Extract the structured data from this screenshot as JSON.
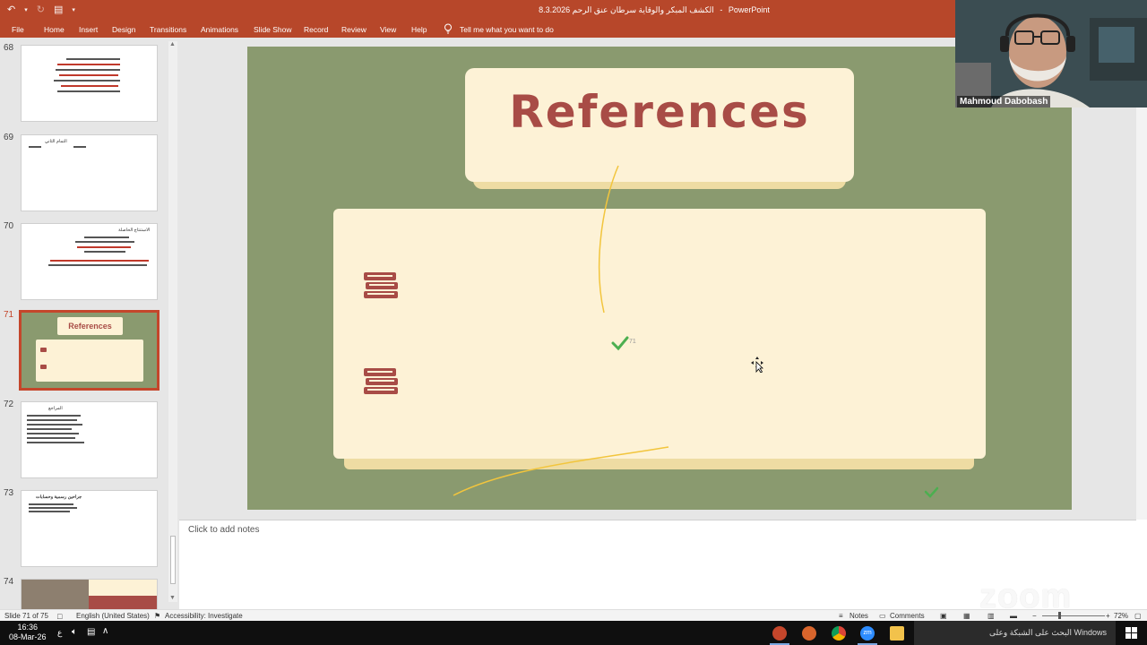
{
  "window": {
    "title": "الكشف المبكر والوقاية سرطان عنق الرحم 8.3.2026",
    "app_name": "PowerPoint",
    "separator": "-"
  },
  "ribbon": {
    "tabs": [
      "File",
      "Home",
      "Insert",
      "Design",
      "Transitions",
      "Animations",
      "Slide Show",
      "Record",
      "Review",
      "View",
      "Help"
    ],
    "tell_me": "Tell me what you want to do"
  },
  "thumbnails": {
    "numbers": [
      "68",
      "69",
      "70",
      "71",
      "72",
      "73",
      "74"
    ],
    "active": "71",
    "texts": {
      "t69": "التمام الثاني",
      "t70": "الاستنتاج الحاصلة",
      "t71": "References",
      "t72": "المراجع",
      "t73": "جراحين رسمية وحسابات"
    }
  },
  "slide": {
    "title": "References",
    "marker": "71"
  },
  "notes": {
    "placeholder": "Click to add notes"
  },
  "statusbar": {
    "slide_info": "Slide 71 of 75",
    "language": "English (United States)",
    "accessibility": "Accessibility: Investigate",
    "notes_label": "Notes",
    "comments_label": "Comments",
    "zoom": "72%",
    "minus": "−",
    "plus": "+"
  },
  "taskbar": {
    "time": "16:36",
    "date": "08-Mar-26",
    "lang": "ع",
    "search_text": "البحث على الشبكة وعلى Windows"
  },
  "webcam": {
    "participant_name": "Mahmoud Dabobash"
  },
  "watermark": {
    "text": "zoom"
  },
  "colors": {
    "ppt_accent": "#b7472a",
    "slide_bg": "#8a9a6f",
    "card": "#fdf2d6",
    "title_text": "#a84c46"
  }
}
